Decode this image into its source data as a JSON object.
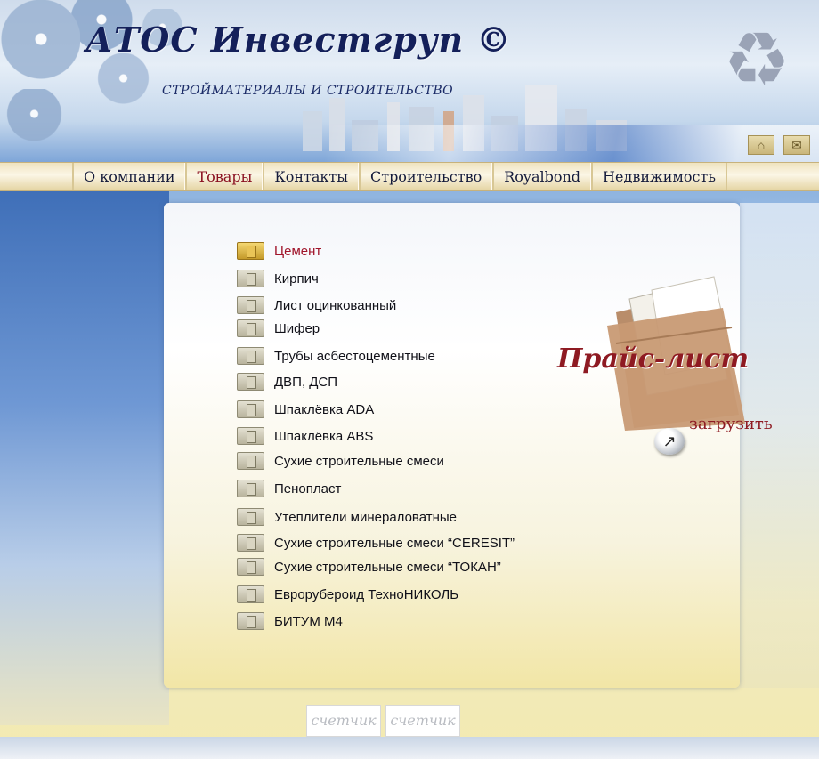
{
  "header": {
    "logo": "АТОС Инвестгруп ©",
    "tagline": "СТРОЙМАТЕРИАЛЫ И СТРОИТЕЛЬСТВО",
    "recycle_icon": "recycle-icon",
    "home_icon": "home-icon",
    "mail_icon": "mail-icon"
  },
  "nav": {
    "items": [
      {
        "label": "О компании"
      },
      {
        "label": "Товары",
        "active": true
      },
      {
        "label": "Контакты"
      },
      {
        "label": "Строительство"
      },
      {
        "label": "Royalbond"
      },
      {
        "label": "Недвижимость"
      }
    ]
  },
  "products": [
    {
      "label": "Цемент",
      "current": true
    },
    {
      "label": "Кирпич"
    },
    {
      "label": "Лист оцинкованный"
    },
    {
      "label": "Шифер"
    },
    {
      "label": "Трубы асбестоцементные"
    },
    {
      "label": "ДВП, ДСП"
    },
    {
      "label": "Шпаклёвка ADA"
    },
    {
      "label": "Шпаклёвка ABS"
    },
    {
      "label": "Сухие строительные смеси"
    },
    {
      "label": "Пенопласт"
    },
    {
      "label": "Утеплители минераловатные"
    },
    {
      "label": "Сухие строительные смеси “CERESIT”"
    },
    {
      "label": "Сухие строительные смеси “ТОКАН”"
    },
    {
      "label": "Еврорубероид ТехноНИКОЛЬ"
    },
    {
      "label": "БИТУМ М4"
    }
  ],
  "price_list": {
    "title": "Прайс-лист",
    "download_label": "загрузить",
    "download_icon": "arrow-up-right-icon"
  },
  "counters": [
    "счетчик",
    "счетчик"
  ],
  "colors": {
    "brand_navy": "#14205a",
    "accent_red": "#8e1a22",
    "nav_active": "#8a1020"
  }
}
